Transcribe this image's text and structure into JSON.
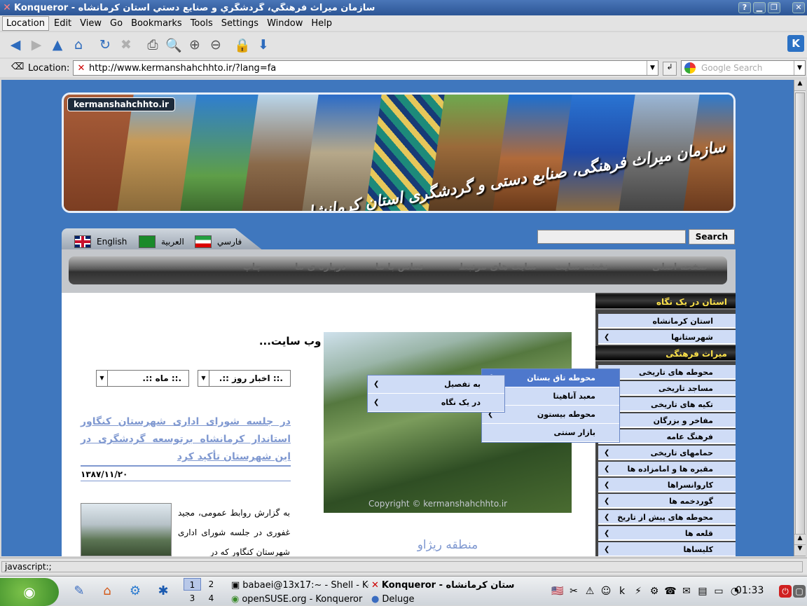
{
  "window": {
    "title": "Konqueror - سازمان ميراث فرهنگي، گردشگري و صنايع دستي استان كرمانشاه"
  },
  "menubar": [
    "Location",
    "Edit",
    "View",
    "Go",
    "Bookmarks",
    "Tools",
    "Settings",
    "Window",
    "Help"
  ],
  "location": {
    "label": "Location:",
    "url": "http://www.kermanshahchhto.ir/?lang=fa",
    "search_placeholder": "Google Search"
  },
  "status": "javascript:;",
  "site": {
    "banner_url": "kermanshahchhto.ir",
    "banner_title": "سازمان میراث فرهنگی، صنایع دستی و گردشگری استان کرمانشاه",
    "languages": [
      "English",
      "العربية",
      "فارسي"
    ],
    "search_button": "Search",
    "nav": [
      "صفحه اصلی",
      "نقشه سایت",
      "سایت های مرتبط",
      "تماس با ما",
      "درباره ی ما",
      "چاپ"
    ],
    "news_heading": "اخبار وب سایت...",
    "select_day": ".:: اخبار روز ::.",
    "select_month": ".:: ماه ::.",
    "headline": "در جلسه شورای اداری شهرستان کنگاور استاندار کرمانشاه برتوسعه گردشگری در این شهرستان تأکید کرد",
    "date": "۱۳۸۷/۱۱/۲۰",
    "body": "به گزارش روابط عمومی، مجید غفوری در جلسه شورای اداری شهرستان کنگاور که در",
    "photo_copyright": "Copyright © kermanshahchhto.ir",
    "photo_caption": "منطقه ریژاو",
    "sidebar": {
      "head1": "استان در یک نگاه",
      "items1": [
        "استان کرمانشاه",
        "شهرستانها"
      ],
      "head2": "میراث فرهنگی",
      "items2": [
        "محوطه های تاریخی",
        "مساجد تاریخی",
        "تکیه های تاریخی",
        "مفاخر و بزرگان",
        "فرهنگ عامه",
        "حمامهای تاریخی",
        "مقبره ها و امامزاده ها",
        "کاروانسراها",
        "گوردخمه ها",
        "محوطه های پیش از تاریخ",
        "قلعه ها",
        "کلیساها"
      ]
    },
    "popup1": [
      "محوطه تاق بستان",
      "معبد آناهیتا",
      "محوطه بیستون",
      "بازار سنتی"
    ],
    "popup2": [
      "به تفصیل",
      "در یک نگاه"
    ]
  },
  "taskbar": {
    "pager": [
      "1",
      "2",
      "3",
      "4"
    ],
    "tasks": [
      "babaei@13x17:~ - Shell - Ko",
      "Konqueror - ستان كرمانشاه",
      "openSUSE.org - Konqueror",
      "Deluge"
    ],
    "clock": "01:33"
  },
  "colors": {
    "site_bg": "#3f77be",
    "accent_link": "#7f98d0",
    "menu_highlight": "#4e78cc"
  }
}
